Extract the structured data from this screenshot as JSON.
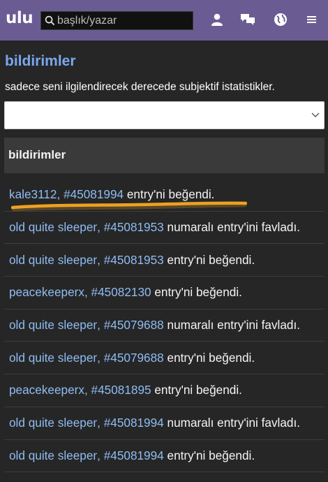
{
  "header": {
    "logo": "ulu",
    "search_placeholder": "başlık/yazar",
    "icons": [
      "user-icon",
      "messages-icon",
      "globe-icon",
      "menu-icon"
    ],
    "bg_color": "#6a5c92"
  },
  "page": {
    "title": "bildirimler",
    "subtitle": "sadece seni ilgilendirecek derecede subjektif istatistikler.",
    "filter_value": ""
  },
  "section": {
    "title": "bildirimler"
  },
  "notifications": [
    {
      "user": "kale3112",
      "sep": ", ",
      "entry": "#45081994",
      "action": " entry'ni beğendi."
    },
    {
      "user": "old quite sleeper",
      "sep": ", ",
      "entry": "#45081953",
      "action": " numaralı entry'ini favladı."
    },
    {
      "user": "old quite sleeper",
      "sep": ", ",
      "entry": "#45081953",
      "action": " entry'ni beğendi."
    },
    {
      "user": "peacekeeperx",
      "sep": ", ",
      "entry": "#45082130",
      "action": " entry'ni beğendi."
    },
    {
      "user": "old quite sleeper",
      "sep": ", ",
      "entry": "#45079688",
      "action": " numaralı entry'ini favladı."
    },
    {
      "user": "old quite sleeper",
      "sep": ", ",
      "entry": "#45079688",
      "action": " entry'ni beğendi."
    },
    {
      "user": "peacekeeperx",
      "sep": ", ",
      "entry": "#45081895",
      "action": " entry'ni beğendi."
    },
    {
      "user": "old quite sleeper",
      "sep": ", ",
      "entry": "#45081994",
      "action": " numaralı entry'ini favladı."
    },
    {
      "user": "old quite sleeper",
      "sep": ", ",
      "entry": "#45081994",
      "action": " entry'ni beğendi."
    }
  ],
  "colors": {
    "link": "#8fbcf2",
    "title": "#7aa7f0",
    "highlight": "#f5a623"
  }
}
